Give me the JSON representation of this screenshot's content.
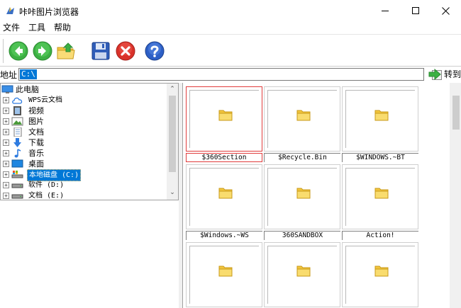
{
  "window": {
    "title": "咔咔图片浏览器"
  },
  "menu": {
    "items": [
      "文件",
      "工具",
      "帮助"
    ]
  },
  "toolbar": {
    "buttons": [
      "back-icon",
      "forward-icon",
      "up-folder-icon",
      "save-icon",
      "delete-icon",
      "help-icon"
    ]
  },
  "address": {
    "label": "地址",
    "value": "C:\\",
    "go_label": "转到"
  },
  "tree": {
    "items": [
      {
        "label": "此电脑",
        "icon": "computer-icon",
        "expander": ""
      },
      {
        "label": "WPS云文档",
        "icon": "cloud-icon",
        "expander": "+"
      },
      {
        "label": "视频",
        "icon": "video-folder-icon",
        "expander": "+"
      },
      {
        "label": "图片",
        "icon": "pictures-folder-icon",
        "expander": "+"
      },
      {
        "label": "文档",
        "icon": "documents-folder-icon",
        "expander": "+"
      },
      {
        "label": "下载",
        "icon": "downloads-folder-icon",
        "expander": "+"
      },
      {
        "label": "音乐",
        "icon": "music-folder-icon",
        "expander": "+"
      },
      {
        "label": "桌面",
        "icon": "desktop-folder-icon",
        "expander": "+"
      },
      {
        "label": "本地磁盘 (C:)",
        "icon": "system-drive-icon",
        "expander": "+",
        "selected": true
      },
      {
        "label": "软件 (D:)",
        "icon": "drive-icon",
        "expander": "+"
      },
      {
        "label": "文档 (E:)",
        "icon": "drive-icon",
        "expander": "+"
      }
    ]
  },
  "thumbnails": {
    "items": [
      {
        "label": "$360Section",
        "selected": true
      },
      {
        "label": "$Recycle.Bin"
      },
      {
        "label": "$WINDOWS.~BT"
      },
      {
        "label": "$Windows.~WS"
      },
      {
        "label": "360SANDBOX"
      },
      {
        "label": "Action!"
      },
      {
        "label": ""
      },
      {
        "label": ""
      },
      {
        "label": ""
      }
    ]
  },
  "colors": {
    "selection": "#0078d7",
    "selected_border": "#e03b3b",
    "folder": "#f7d24a"
  }
}
